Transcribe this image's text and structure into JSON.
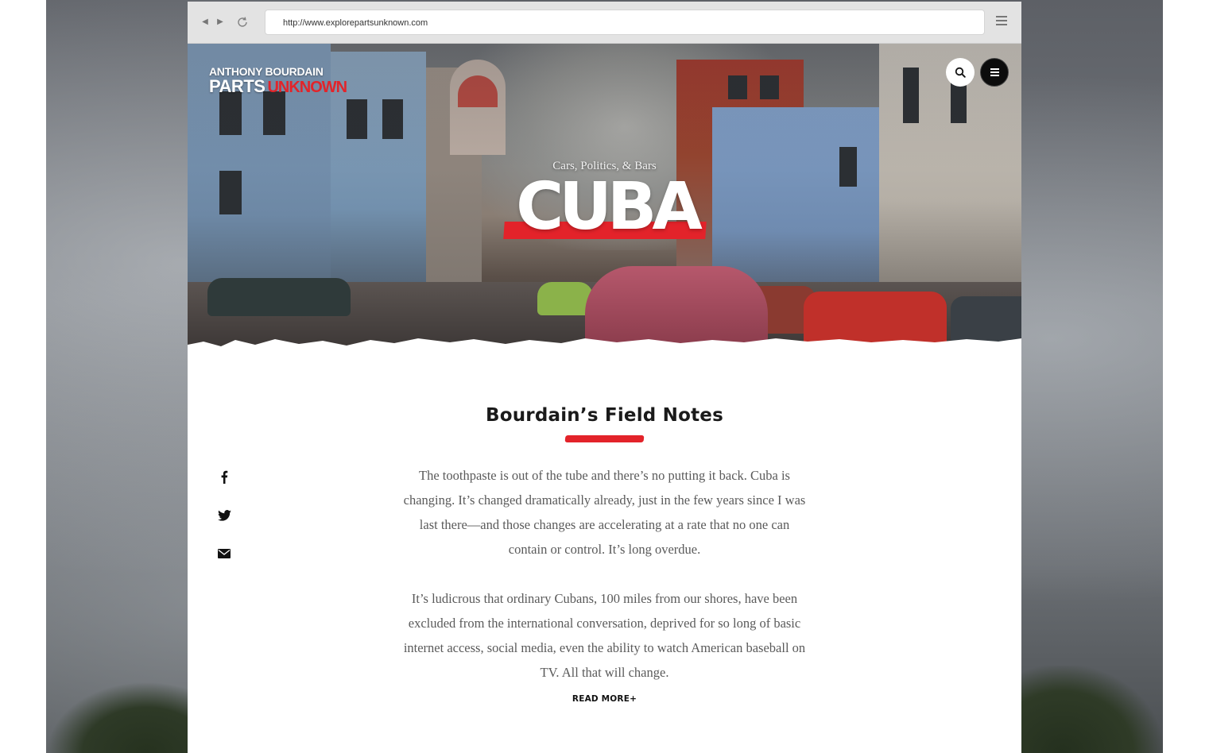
{
  "browser": {
    "url": "http://www.explorepartsunknown.com"
  },
  "brand": {
    "line1": "ANTHONY BOURDAIN",
    "line2a": "PARTS",
    "line2b": "UNKNOWN",
    "accent_color": "#e3232a"
  },
  "hero": {
    "subtitle": "Cars, Politics, & Bars",
    "title": "CUBA"
  },
  "section": {
    "title": "Bourdain’s Field Notes",
    "paragraph1": "The toothpaste is out of the tube and there’s no putting it back. Cuba is changing. It’s changed dramatically already, just in the few years since I was last there—and those changes are accelerating at a rate that no one can contain or control. It’s long overdue.",
    "paragraph2": "It’s ludicrous that ordinary Cubans, 100 miles from our shores, have been excluded from the international conversation, deprived for so long of basic internet access, social media, even the ability to watch American baseball on TV. All that will change.",
    "read_more": "READ MORE+"
  },
  "social": {
    "icons": [
      "facebook-icon",
      "twitter-icon",
      "email-icon"
    ]
  }
}
